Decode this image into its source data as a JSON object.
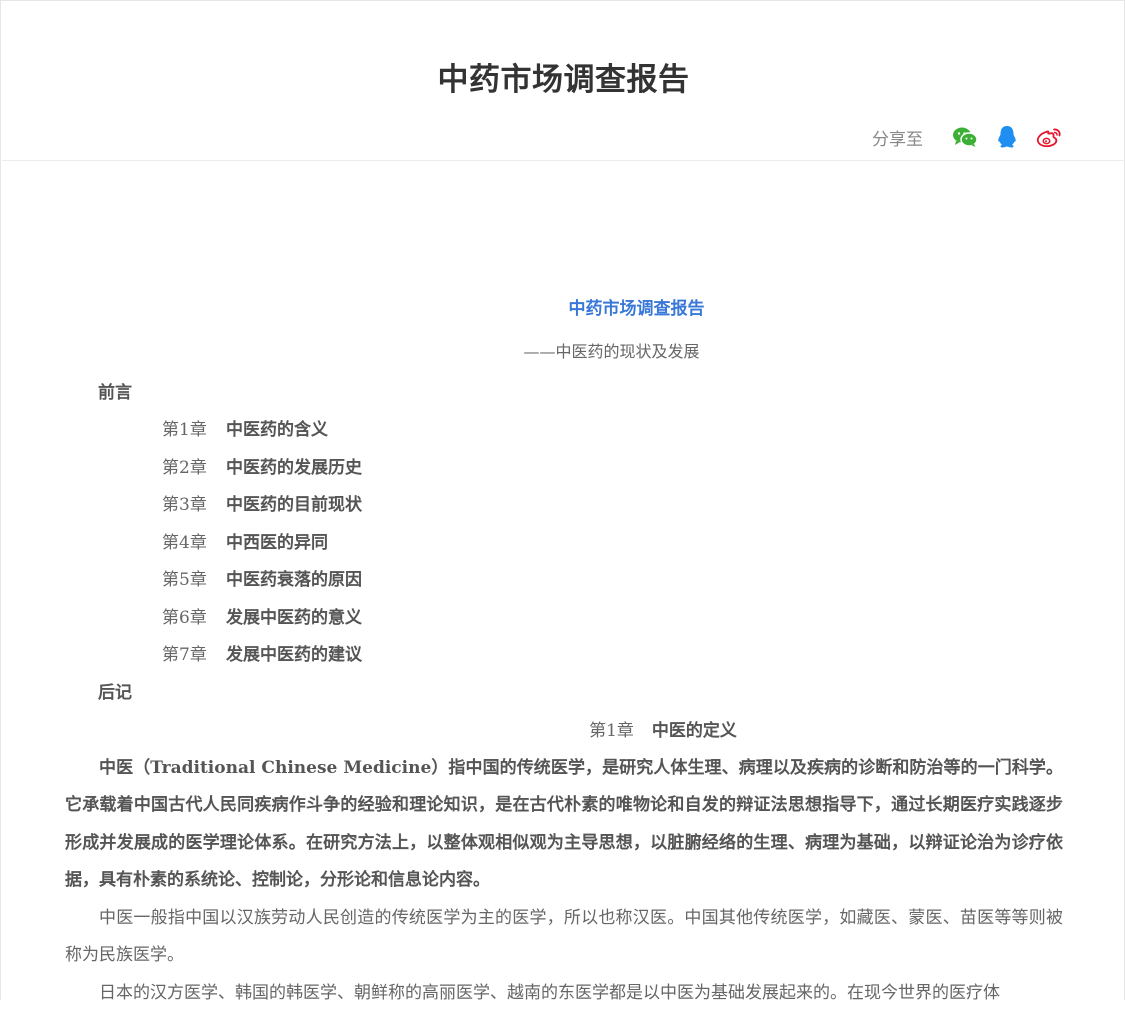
{
  "header": {
    "title": "中药市场调查报告",
    "share_label": "分享至",
    "share_icons": [
      "wechat-icon",
      "qq-icon",
      "weibo-icon"
    ],
    "colors": {
      "wechat": "#3cb034",
      "qq": "#1e8ff0",
      "weibo": "#e6162d"
    }
  },
  "article": {
    "title": "中药市场调查报告",
    "subtitle": "——中医药的现状及发展",
    "preface": "前言",
    "toc": [
      {
        "chapter": "第1章",
        "name": "中医药的含义"
      },
      {
        "chapter": "第2章",
        "name": "中医药的发展历史"
      },
      {
        "chapter": "第3章",
        "name": "中医药的目前现状"
      },
      {
        "chapter": "第4章",
        "name": "中西医的异同"
      },
      {
        "chapter": "第5章",
        "name": "中医药衰落的原因"
      },
      {
        "chapter": "第6章",
        "name": "发展中医药的意义"
      },
      {
        "chapter": "第7章",
        "name": "发展中医药的建议"
      }
    ],
    "postscript": "后记",
    "chapter1": {
      "chapter": "第1章",
      "name": "中医的定义",
      "paragraphs": [
        "中医（Traditional Chinese Medicine）指中国的传统医学，是研究人体生理、病理以及疾病的诊断和防治等的一门科学。它承载着中国古代人民同疾病作斗争的经验和理论知识，是在古代朴素的唯物论和自发的辩证法思想指导下，通过长期医疗实践逐步形成并发展成的医学理论体系。在研究方法上，以整体观相似观为主导思想，以脏腑经络的生理、病理为基础，以辩证论治为诊疗依据，具有朴素的系统论、控制论，分形论和信息论内容。",
        "中医一般指中国以汉族劳动人民创造的传统医学为主的医学，所以也称汉医。中国其他传统医学，如藏医、蒙医、苗医等等则被称为民族医学。",
        "日本的汉方医学、韩国的韩医学、朝鲜称的高丽医学、越南的东医学都是以中医为基础发展起来的。在现今世界的医疗体"
      ]
    },
    "title_color": "#3a78d8"
  }
}
